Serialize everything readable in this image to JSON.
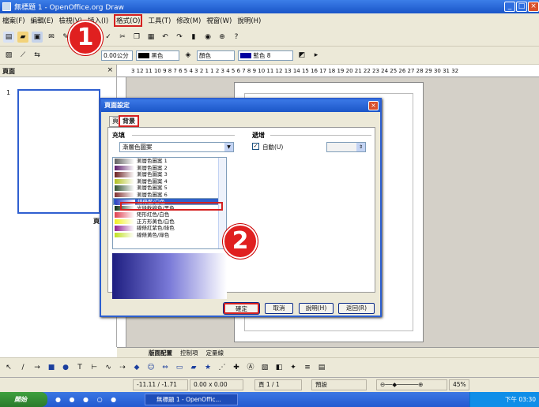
{
  "window": {
    "title": "無標題 1 - OpenOffice.org Draw",
    "minimize": "_",
    "maximize": "□",
    "close": "×"
  },
  "menu": [
    "檔案(F)",
    "編輯(E)",
    "檢視(V)",
    "插入(I)",
    "格式(O)",
    "工具(T)",
    "修改(M)",
    "視窗(W)",
    "說明(H)"
  ],
  "toolbar2": {
    "size_value": "0.00公分",
    "color1": "黑色",
    "color2": "顏色",
    "color3": "藍色 8"
  },
  "left_panel": {
    "title": "頁面",
    "close": "×",
    "slide_number": "1",
    "slide_label": "頁"
  },
  "ruler": {
    "numbers": "3 12 11 10 9 8 7 6 5 4 3 2 1   1 2 3 4 5 6 7 8 9 10 11 12 13 14 15 16 17 18 19 20 21 22 23 24 25 26 27 28 29 30 31 32"
  },
  "tabs_row": [
    "版面配置",
    "控制項",
    "定量線"
  ],
  "statusbar": {
    "coords": "-11.11 / -1.71",
    "size": "0.00 x 0.00",
    "page": "頁 1 / 1",
    "style": "預設",
    "zoom": "45%"
  },
  "taskbar": {
    "start": "開始",
    "task": "無標題 1 - OpenOffic...",
    "time": "下午 03:30"
  },
  "dialog": {
    "title": "頁面設定",
    "tabs": [
      "頁",
      "背景"
    ],
    "fill_group": "充填",
    "fill_type": "漸層色圖案",
    "increments_group": "遞增",
    "auto_label": "自動(U)",
    "gradients": [
      {
        "name": "漸層色圖案 1",
        "color": "#606060"
      },
      {
        "name": "漸層色圖案 2",
        "color": "#5a1a6a"
      },
      {
        "name": "漸層色圖案 3",
        "color": "#6a2020"
      },
      {
        "name": "漸層色圖案 4",
        "color": "#b0c020"
      },
      {
        "name": "漸層色圖案 5",
        "color": "#305030"
      },
      {
        "name": "漸層色圖案 6",
        "color": "#803030"
      },
      {
        "name": "線條藍/白色",
        "color": "#3040c0"
      },
      {
        "name": "光綠軟線色/黑色",
        "color": "#103010"
      },
      {
        "name": "矩形紅色/白色",
        "color": "#e04050"
      },
      {
        "name": "正方形黃色/白色",
        "color": "#f0f020"
      },
      {
        "name": "線條紅紫色/綠色",
        "color": "#902090"
      },
      {
        "name": "線條黃色/綠色",
        "color": "#c0e020"
      }
    ],
    "buttons": {
      "ok": "確定",
      "cancel": "取消",
      "help": "說明(H)",
      "reset": "返回(R)"
    }
  },
  "callouts": [
    "1",
    "2"
  ]
}
